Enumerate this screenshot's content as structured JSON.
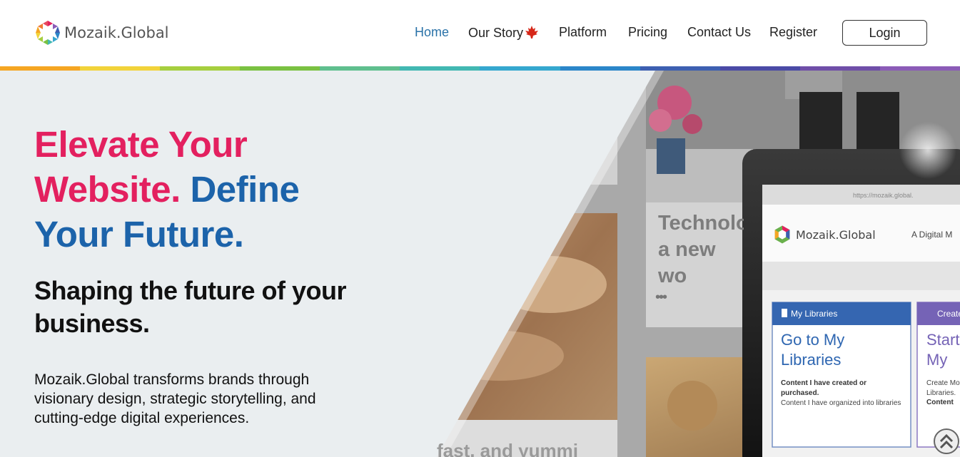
{
  "brand": {
    "name": "Mozaik.Global"
  },
  "nav": {
    "home": "Home",
    "our_story": "Our Story",
    "platform": "Platform",
    "pricing": "Pricing",
    "contact_us": "Contact Us",
    "register": "Register",
    "login": "Login"
  },
  "colors": {
    "accent_pink": "#e3205f",
    "accent_blue": "#1c63aa",
    "nav_active": "#2a72a8",
    "stripe": [
      "#f5a623",
      "#f2d33a",
      "#a6cf3f",
      "#7ac142",
      "#5fbf8e",
      "#42b8b2",
      "#35a7cf",
      "#2b86c9",
      "#3d5fb1",
      "#4a4aa6",
      "#6f4ea8",
      "#8b5bb7"
    ]
  },
  "hero": {
    "headline_pink": "Elevate Your Website.",
    "headline_blue": "Define Your Future.",
    "subheading": "Shaping the future of your business.",
    "description": "Mozaik.Global transforms brands through visionary design, strategic storytelling, and cutting-edge digital experiences."
  },
  "background": {
    "card_title": "Technolo a new wo",
    "card_caption": "fast, and yummi",
    "more_dots": "•••"
  },
  "device": {
    "url": "https://mozaik.global.",
    "brand": "Mozaik.Global",
    "tagline": "A Digital M",
    "card1": {
      "header": "My Libraries",
      "title": "Go to My Libraries",
      "text_bold": "Content I have created or purchased.",
      "text": "Content I have organized into libraries"
    },
    "card2": {
      "header": "Create",
      "title": "Start My C",
      "text": "Create Mo Libraries.",
      "text_bold": "Content"
    }
  },
  "icons": {
    "logo": "mozaik-logo-icon",
    "leaf": "maple-leaf-icon",
    "scroll_top": "double-chevron-up-icon"
  }
}
